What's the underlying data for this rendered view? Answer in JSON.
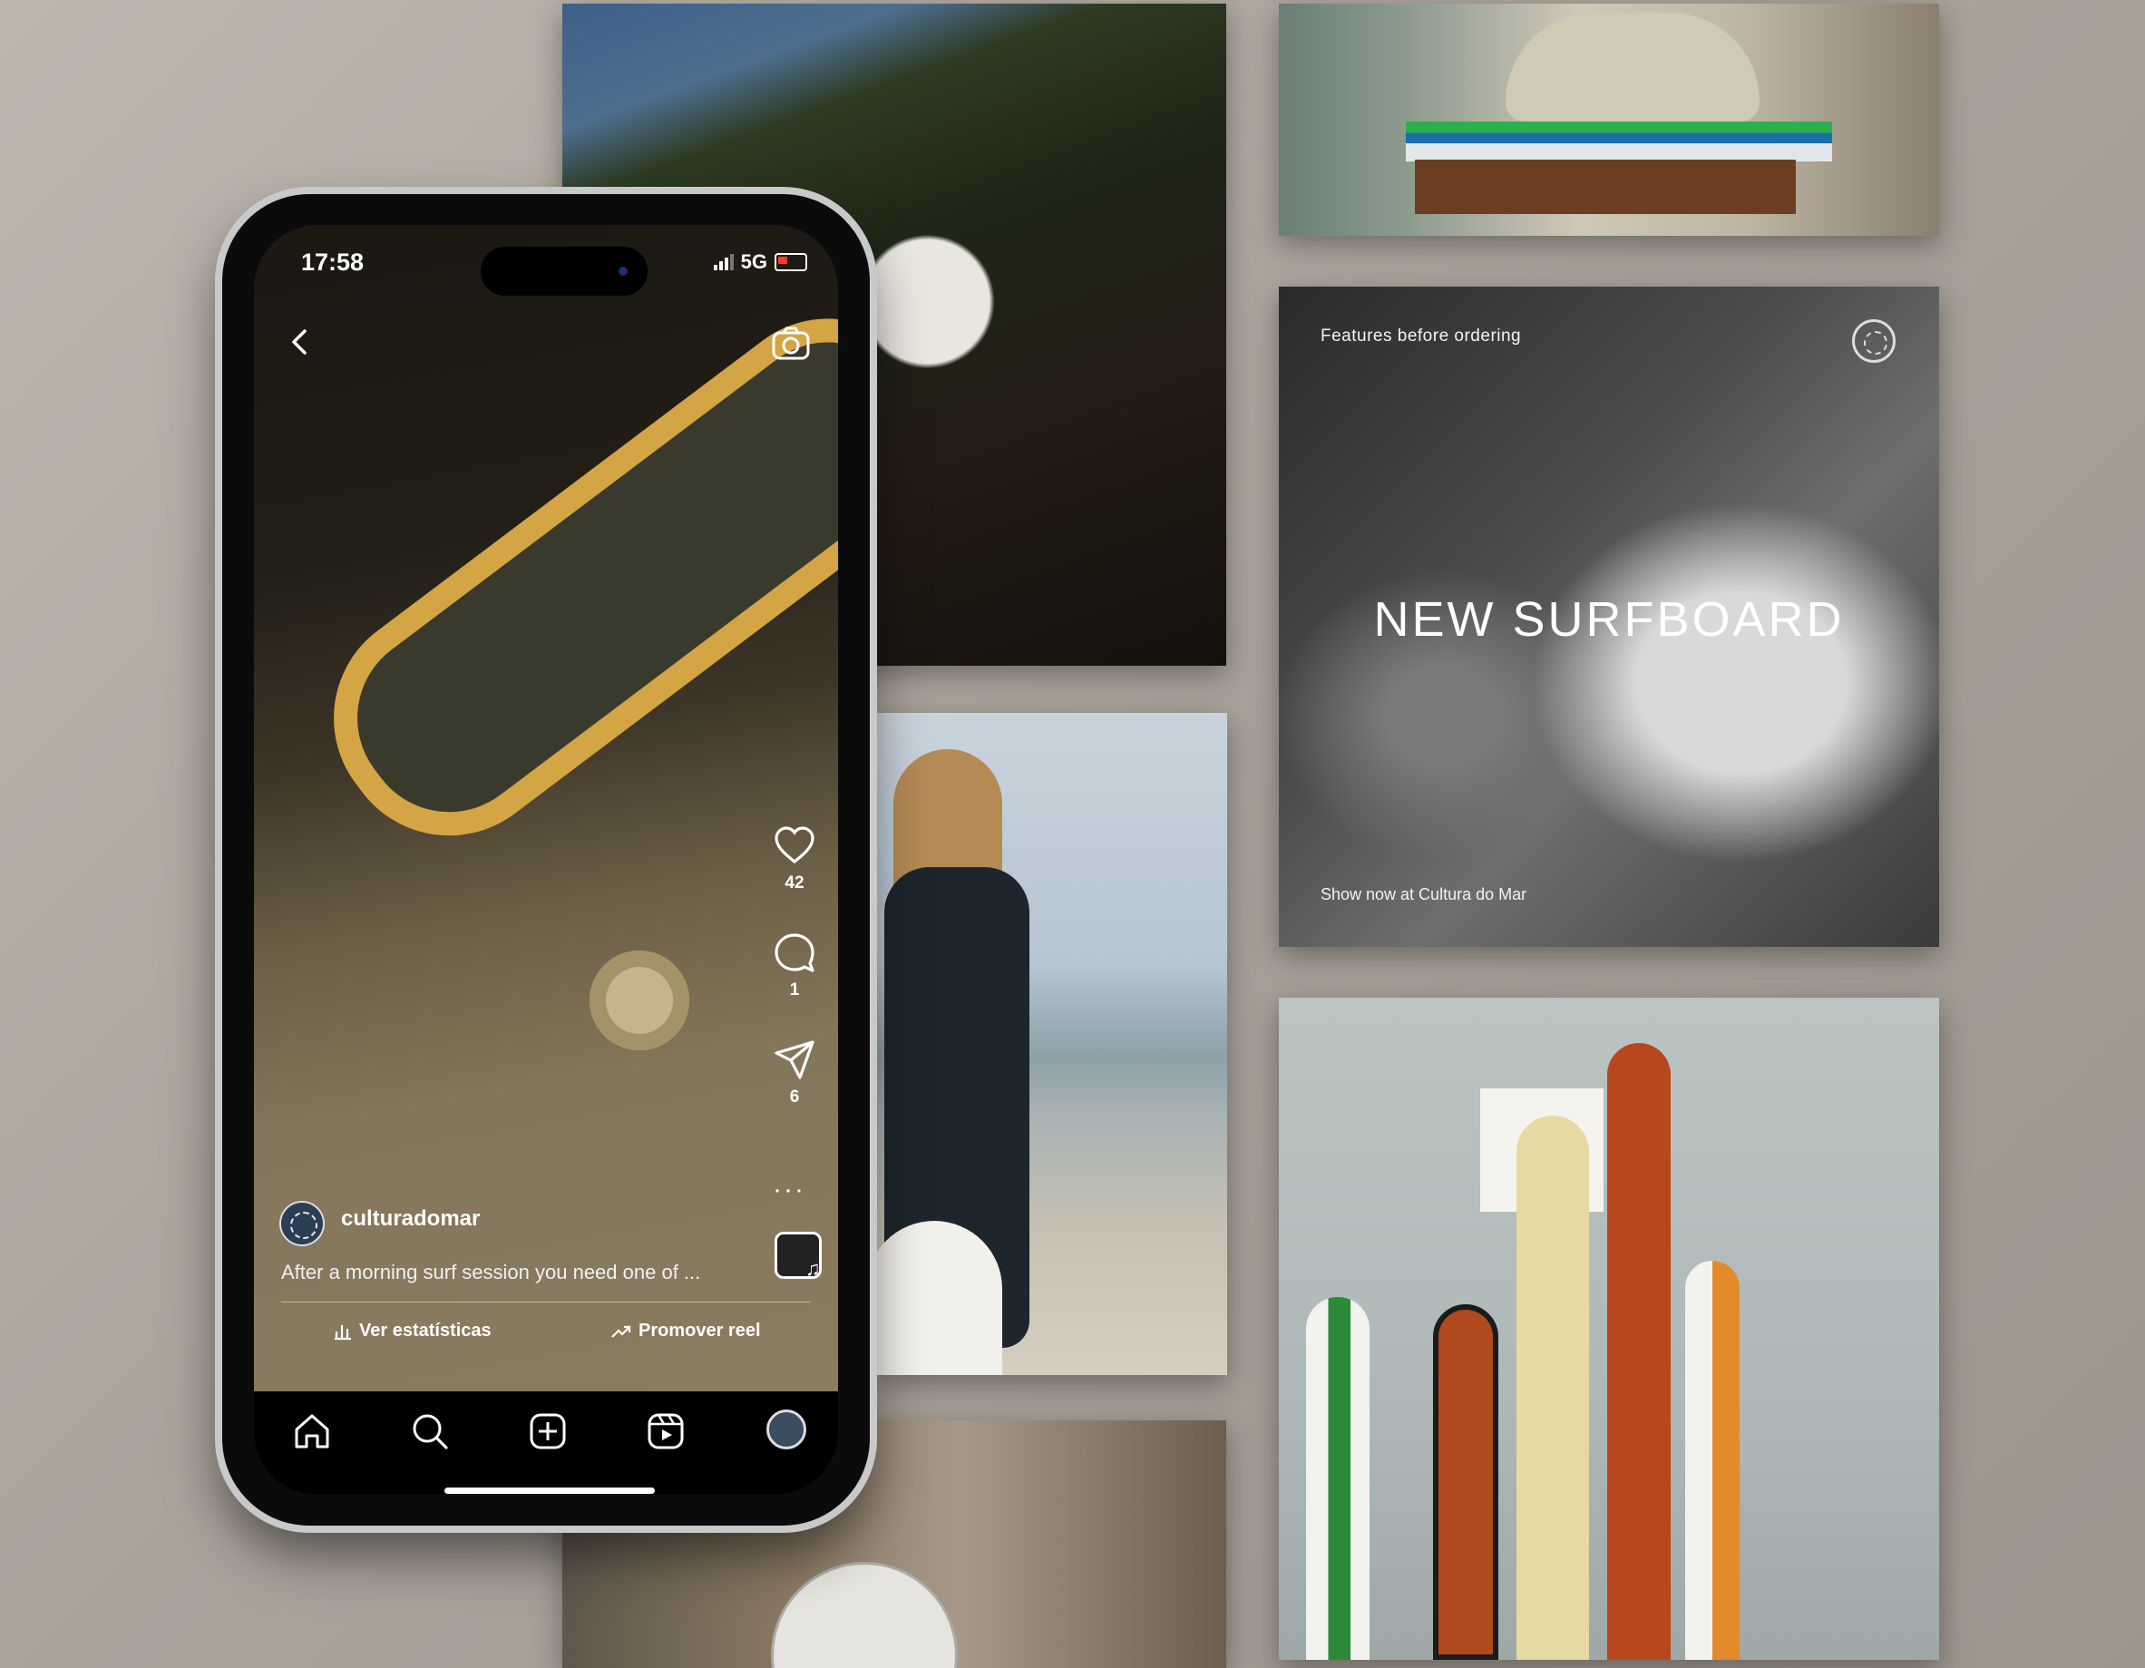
{
  "phone": {
    "status_bar": {
      "time": "17:58",
      "network": "5G"
    },
    "reel": {
      "likes": "42",
      "comments": "1",
      "shares": "6",
      "more": "···",
      "username": "culturadomar",
      "caption": "After a morning surf session you need one of ...",
      "stats_button": "Ver estatísticas",
      "promote_button": "Promover reel"
    },
    "icons": {
      "back": "chevron-left-icon",
      "camera": "camera-icon",
      "like": "heart-icon",
      "comment": "comment-icon",
      "share": "paper-plane-icon",
      "stats": "bar-chart-icon",
      "promote": "trend-arrow-icon",
      "music": "music-note-icon"
    },
    "tab_bar": [
      "home-icon",
      "search-icon",
      "add-post-icon",
      "reels-icon",
      "profile-avatar"
    ]
  },
  "promo_card": {
    "top_text": "Features before ordering",
    "headline": "NEW SURFBOARD",
    "bottom_text": "Show now at Cultura do Mar"
  },
  "colors": {
    "background": "#aaa39a",
    "deck_accent": "#d3a544",
    "promo_background": "#3a3a3a",
    "battery_charging": "#ff3b30"
  }
}
